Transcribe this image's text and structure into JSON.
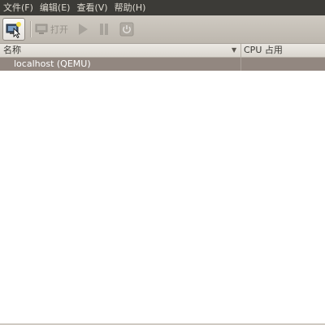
{
  "menubar": {
    "items": [
      "文件(F)",
      "编辑(E)",
      "查看(V)",
      "帮助(H)"
    ]
  },
  "toolbar": {
    "open_label": "打开"
  },
  "table": {
    "columns": [
      "名称",
      "CPU 占用"
    ],
    "rows": [
      {
        "name": "localhost (QEMU)",
        "cpu": ""
      }
    ]
  },
  "colors": {
    "menubar_bg": "#3c3b37",
    "toolbar_bg": "#c7c2ba",
    "selected_row_bg": "#928780"
  }
}
